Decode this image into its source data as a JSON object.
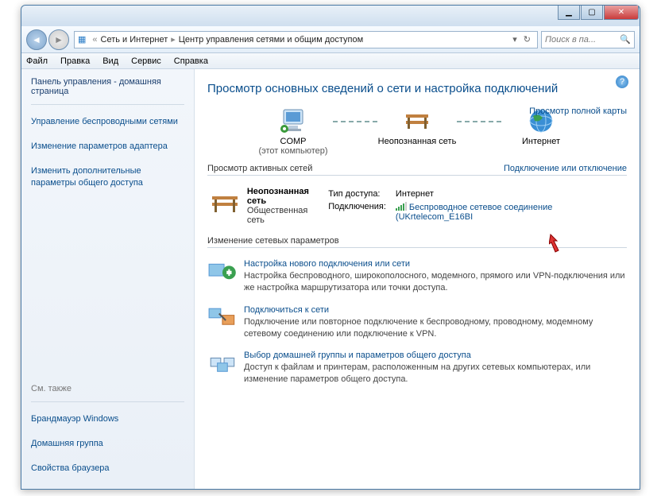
{
  "titlebar": {
    "min": "▁",
    "max": "▢",
    "close": "✕"
  },
  "nav": {
    "back": "◄",
    "fwd": "►",
    "refresh": "↻",
    "dd": "▾"
  },
  "breadcrumb": {
    "icon": "🌐",
    "root_sep": "«",
    "a": "Сеть и Интернет",
    "b": "Центр управления сетями и общим доступом",
    "sep": "▸"
  },
  "search": {
    "placeholder": "Поиск в па...",
    "glyph": "🔍"
  },
  "menu": [
    "Файл",
    "Правка",
    "Вид",
    "Сервис",
    "Справка"
  ],
  "sidebar": {
    "head": "Панель управления - домашняя страница",
    "links": [
      "Управление беспроводными сетями",
      "Изменение параметров адаптера",
      "Изменить дополнительные параметры общего доступа"
    ],
    "see": "См. также",
    "see_links": [
      "Брандмауэр Windows",
      "Домашняя группа",
      "Свойства браузера"
    ]
  },
  "main": {
    "title": "Просмотр основных сведений о сети и настройка подключений",
    "fullmap": "Просмотр полной карты",
    "nodes": {
      "comp": "COMP",
      "comp_sub": "(этот компьютер)",
      "unk": "Неопознанная сеть",
      "inet": "Интернет"
    },
    "active": "Просмотр активных сетей",
    "connect": "Подключение или отключение",
    "net": {
      "name": "Неопознанная сеть",
      "type": "Общественная сеть"
    },
    "props": {
      "atype_l": "Тип доступа:",
      "atype_v": "Интернет",
      "conn_l": "Подключения:",
      "conn_v": "Беспроводное сетевое соединение (UKrtelecom_E16BI"
    },
    "change": "Изменение сетевых параметров",
    "opts": [
      {
        "t": "Настройка нового подключения или сети",
        "d": "Настройка беспроводного, широкополосного, модемного, прямого или VPN-подключения или же настройка маршрутизатора или точки доступа."
      },
      {
        "t": "Подключиться к сети",
        "d": "Подключение или повторное подключение к беспроводному, проводному, модемному сетевому соединению или подключение к VPN."
      },
      {
        "t": "Выбор домашней группы и параметров общего доступа",
        "d": "Доступ к файлам и принтерам, расположенным на других сетевых компьютерах, или изменение параметров общего доступа."
      }
    ]
  },
  "help": "?"
}
